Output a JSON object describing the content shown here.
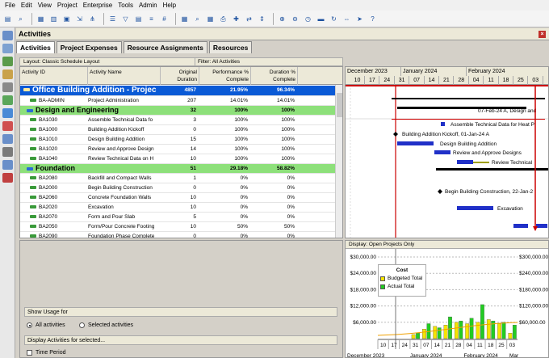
{
  "menu": [
    "File",
    "Edit",
    "View",
    "Project",
    "Enterprise",
    "Tools",
    "Admin",
    "Help"
  ],
  "window": {
    "title": "Activities",
    "close": "×"
  },
  "tabs": [
    {
      "label": "Activities"
    },
    {
      "label": "Project Expenses"
    },
    {
      "label": "Resource Assignments"
    },
    {
      "label": "Resources"
    }
  ],
  "layout_bar": {
    "layout": "Layout: Classic Schedule Layout",
    "filter": "Filter: All Activities"
  },
  "columns": {
    "id": "Activity ID",
    "name": "Activity Name",
    "dur1": "Original",
    "dur2": "Duration",
    "perf1": "Performance %",
    "perf2": "Complete",
    "dpc1": "Duration %",
    "dpc2": "Complete"
  },
  "rows": [
    {
      "type": "proj",
      "id": "Office Building Addition - Projec",
      "name": "",
      "dur": "4857",
      "perf": "21.95%",
      "dpc": "96.34%"
    },
    {
      "type": "task",
      "id": "BA-ADMIN",
      "name": "Project Administration",
      "dur": "207",
      "perf": "14.01%",
      "dpc": "14.01%"
    },
    {
      "type": "wbs",
      "id": "Design and Engineering",
      "name": "",
      "dur": "32",
      "perf": "100%",
      "dpc": "100%"
    },
    {
      "type": "task",
      "id": "BA1030",
      "name": "Assemble Technical Data fo",
      "dur": "3",
      "perf": "100%",
      "dpc": "100%"
    },
    {
      "type": "task",
      "id": "BA1000",
      "name": "Building Addition Kickoff",
      "dur": "0",
      "perf": "100%",
      "dpc": "100%"
    },
    {
      "type": "task",
      "id": "BA1010",
      "name": "Design Building Addition",
      "dur": "15",
      "perf": "100%",
      "dpc": "100%"
    },
    {
      "type": "task",
      "id": "BA1020",
      "name": "Review and Approve Design",
      "dur": "14",
      "perf": "100%",
      "dpc": "100%"
    },
    {
      "type": "task",
      "id": "BA1040",
      "name": "Review Technical Data on H",
      "dur": "10",
      "perf": "100%",
      "dpc": "100%"
    },
    {
      "type": "wbs",
      "id": "Foundation",
      "name": "",
      "dur": "51",
      "perf": "29.18%",
      "dpc": "58.82%"
    },
    {
      "type": "task",
      "id": "BA2080",
      "name": "Backfill and Compact Walls",
      "dur": "1",
      "perf": "0%",
      "dpc": "0%"
    },
    {
      "type": "task",
      "id": "BA2000",
      "name": "Begin Building Construction",
      "dur": "0",
      "perf": "0%",
      "dpc": "0%"
    },
    {
      "type": "task",
      "id": "BA2060",
      "name": "Concrete Foundation Walls",
      "dur": "10",
      "perf": "0%",
      "dpc": "0%"
    },
    {
      "type": "task",
      "id": "BA2020",
      "name": "Excavation",
      "dur": "10",
      "perf": "0%",
      "dpc": "0%"
    },
    {
      "type": "task",
      "id": "BA2070",
      "name": "Form and Pour Slab",
      "dur": "5",
      "perf": "0%",
      "dpc": "0%"
    },
    {
      "type": "task",
      "id": "BA2050",
      "name": "Form/Pour Concrete Footing",
      "dur": "10",
      "perf": "50%",
      "dpc": "50%"
    },
    {
      "type": "task",
      "id": "BA2090",
      "name": "Foundation Phase Complete",
      "dur": "0",
      "perf": "0%",
      "dpc": "0%"
    }
  ],
  "gantt": {
    "months": [
      "December 2023",
      "January 2024",
      "February 2024"
    ],
    "weeks": [
      "10",
      "17",
      "24",
      "31",
      "07",
      "14",
      "21",
      "28",
      "04",
      "11",
      "18",
      "25",
      "03"
    ],
    "labels": [
      "07-Feb-24 A, Design and",
      "Assemble Technical Data for Heat P",
      "Building Addition Kickoff, 01-Jan-24 A",
      "Design Building Addition",
      "Review and Approve Designs",
      "Review Technical",
      "Begin Building Construction, 22-Jan-2",
      "Excavation"
    ]
  },
  "usage": {
    "show_usage_for": "Show Usage for",
    "all_activities": "All activities",
    "selected_activities": "Selected activities",
    "display_for_selected": "Display Activities for selected...",
    "time_period": "Time Period"
  },
  "chart_panel": {
    "display": "Display: Open Projects Only",
    "legend_title": "Cost",
    "legend_budgeted": "Budgeted Total",
    "legend_actual": "Actual Total",
    "y_left": [
      "$30,000.00",
      "$24,000.00",
      "$18,000.00",
      "$12,000.00",
      "$6,000.00"
    ],
    "y_right": [
      "$300,000.00",
      "$240,000.00",
      "$180,000.00",
      "$120,000.00",
      "$60,000.00"
    ],
    "weeks": [
      "10",
      "17",
      "24",
      "31",
      "07",
      "14",
      "21",
      "28",
      "04",
      "11",
      "18",
      "25",
      "03"
    ],
    "bottom_months": [
      "December 2023",
      "January 2024",
      "February 2024",
      "Mar"
    ]
  },
  "chart_data": {
    "type": "bar",
    "title": "Cost",
    "categories": [
      "10",
      "17",
      "24",
      "31",
      "07",
      "14",
      "21",
      "28",
      "04",
      "11",
      "18",
      "25",
      "03"
    ],
    "series": [
      {
        "name": "Budgeted Total",
        "values": [
          0,
          0,
          0,
          1500,
          3500,
          4500,
          5000,
          6000,
          5500,
          6000,
          7000,
          5500,
          2000
        ]
      },
      {
        "name": "Actual Total",
        "values": [
          0,
          0,
          0,
          2000,
          5500,
          4000,
          8000,
          6500,
          7500,
          12500,
          6500,
          6000,
          5000
        ]
      }
    ],
    "ylim": [
      0,
      30000
    ],
    "colors": {
      "Budgeted Total": "#f5e400",
      "Actual Total": "#22cc22"
    }
  }
}
